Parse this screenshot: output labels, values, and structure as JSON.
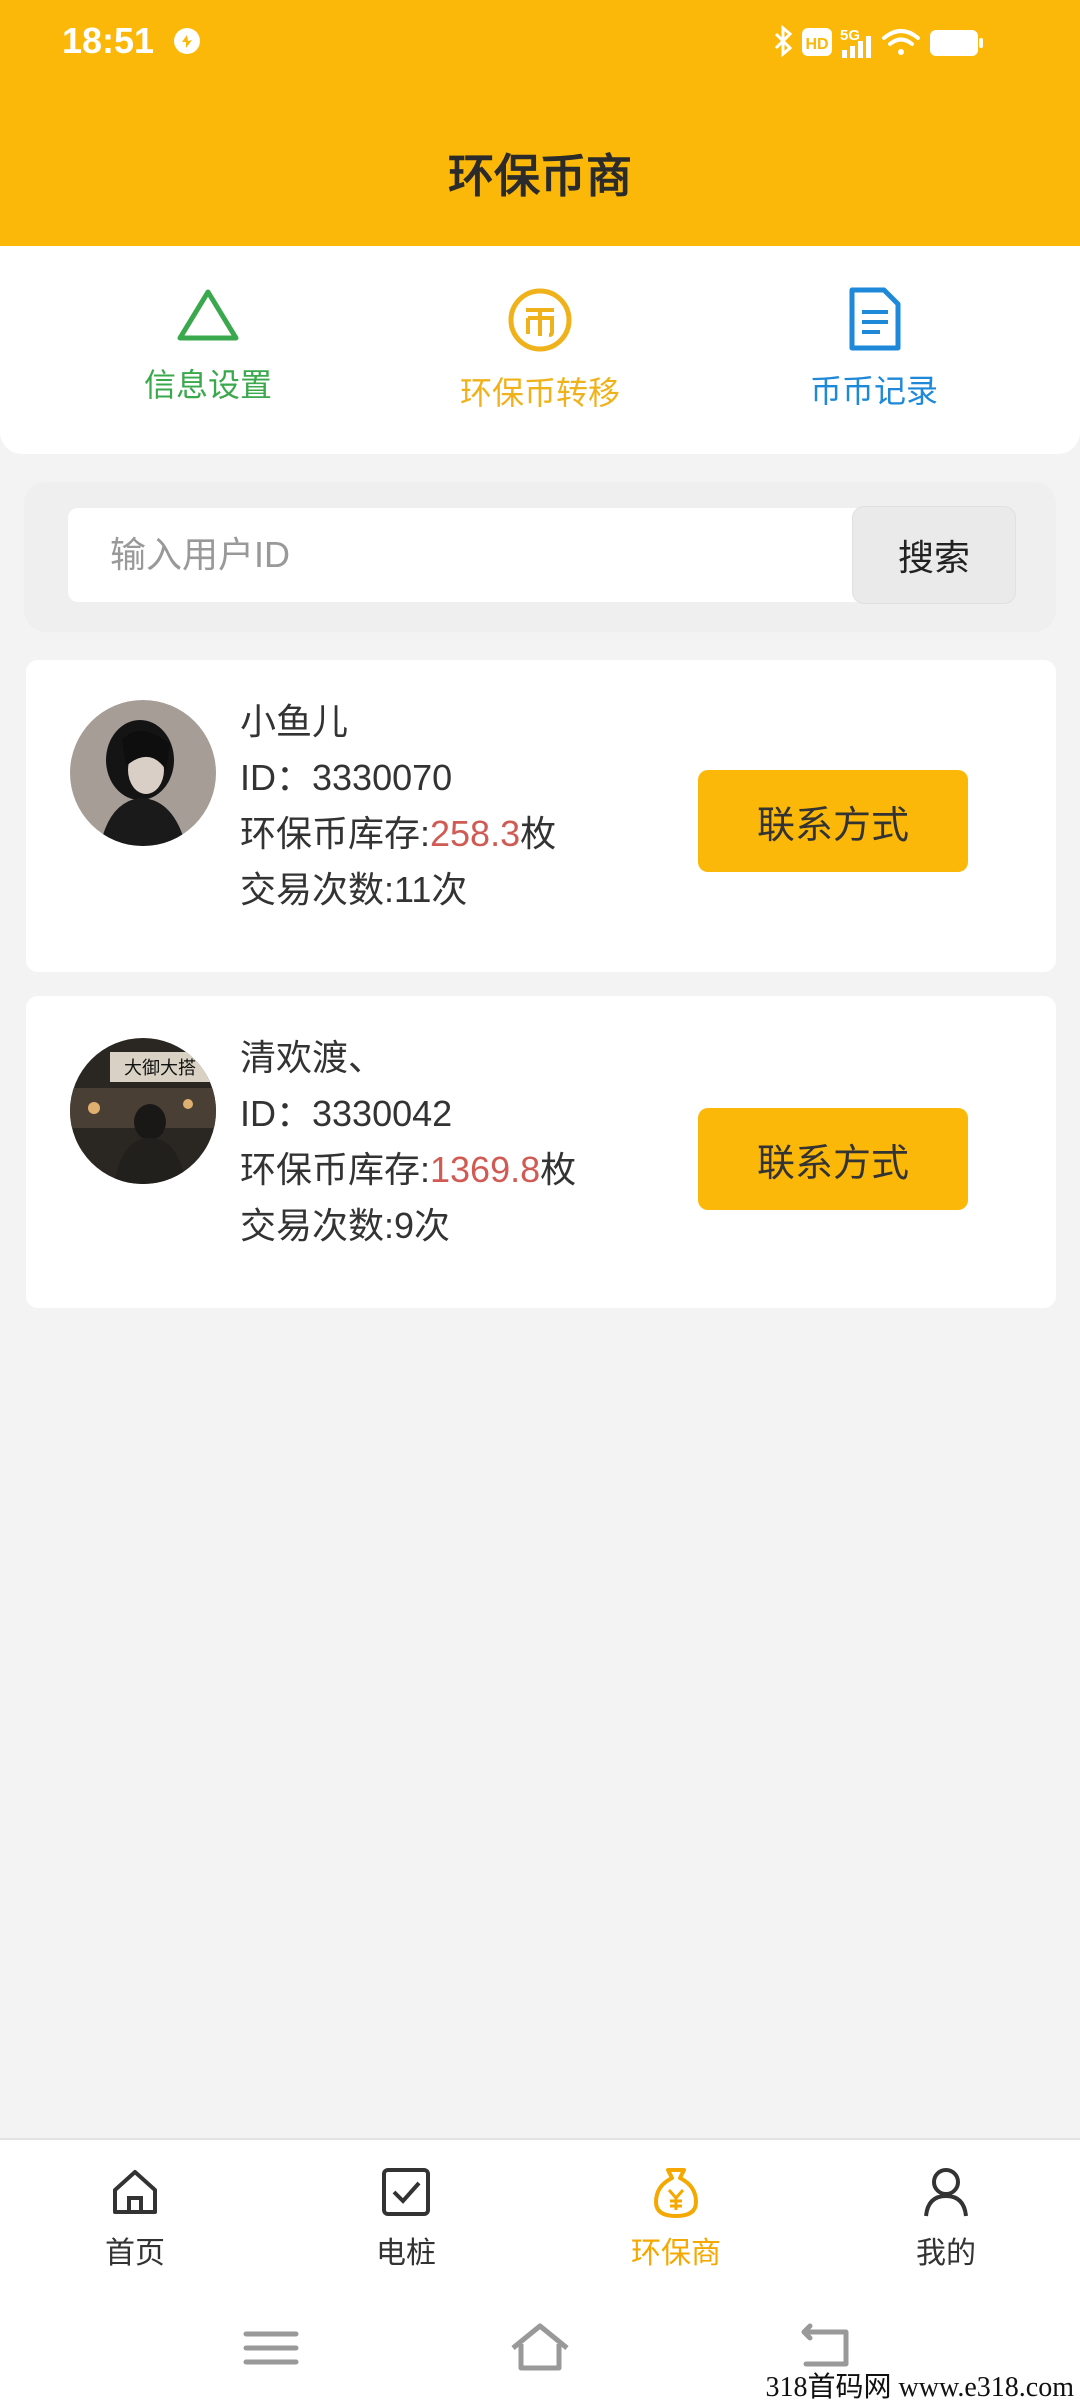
{
  "status_bar": {
    "time": "18:51",
    "hd_badge": "HD",
    "network": "5G"
  },
  "header": {
    "title": "环保币商"
  },
  "quick_menu": [
    {
      "label": "信息设置",
      "icon": "triangle-icon",
      "color": "#3aa84c"
    },
    {
      "label": "环保币转移",
      "icon": "coin-icon",
      "color": "#f0b21a"
    },
    {
      "label": "币币记录",
      "icon": "document-icon",
      "color": "#1e88d9"
    }
  ],
  "search": {
    "placeholder": "输入用户ID",
    "value": "",
    "button_label": "搜索"
  },
  "merchants": [
    {
      "name": "小鱼儿",
      "id_label": "ID：",
      "id": "3330070",
      "stock_label": "环保币库存:",
      "stock_value": "258.3",
      "stock_unit": "枚",
      "trades_label": "交易次数:",
      "trades": "11",
      "trades_unit": "次",
      "contact_label": "联系方式"
    },
    {
      "name": "清欢渡、",
      "id_label": "ID：",
      "id": "3330042",
      "stock_label": "环保币库存:",
      "stock_value": "1369.8",
      "stock_unit": "枚",
      "trades_label": "交易次数:",
      "trades": "9",
      "trades_unit": "次",
      "contact_label": "联系方式"
    }
  ],
  "avatar_sign_text": "大御大搭",
  "tabbar": [
    {
      "label": "首页",
      "icon": "home-icon",
      "active": false
    },
    {
      "label": "电桩",
      "icon": "checkbox-icon",
      "active": false
    },
    {
      "label": "环保商",
      "icon": "money-bag-icon",
      "active": true
    },
    {
      "label": "我的",
      "icon": "user-icon",
      "active": false
    }
  ],
  "watermark": "318首码网 www.e318.com",
  "colors": {
    "accent": "#fbb808",
    "price": "#d05b54",
    "green": "#3aa84c",
    "blue": "#1e88d9"
  }
}
